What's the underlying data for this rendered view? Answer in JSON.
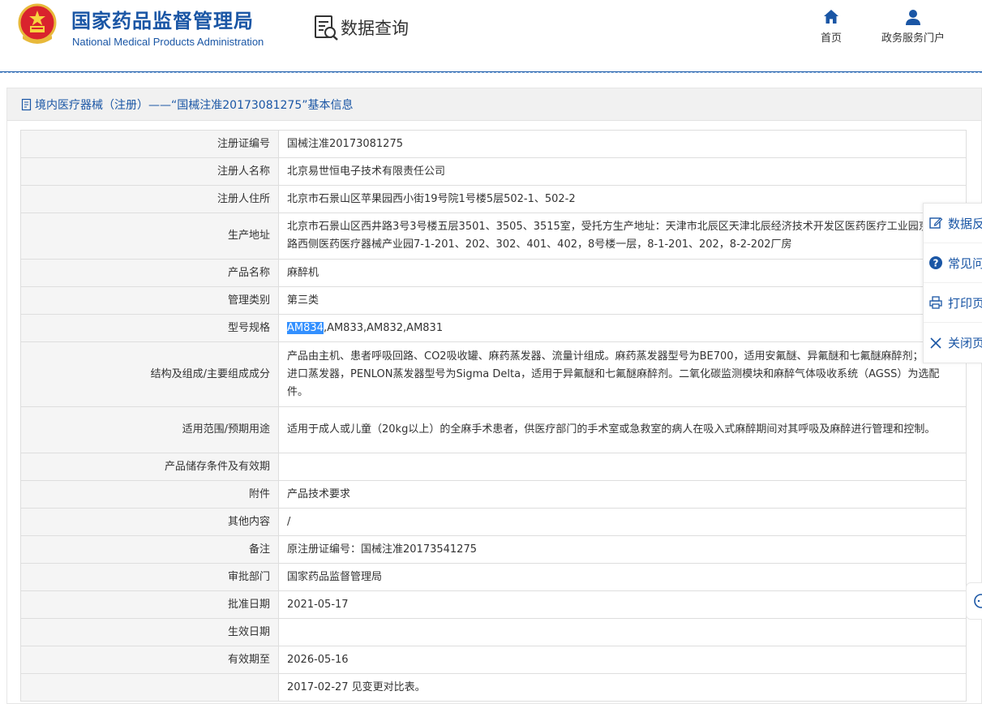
{
  "header": {
    "org_cn": "国家药品监督管理局",
    "org_en": "National Medical Products Administration",
    "query_title": "数据查询",
    "nav": {
      "home": "首页",
      "portal": "政务服务门户"
    }
  },
  "panel": {
    "title": "境内医疗器械（注册）——“国械注准20173081275”基本信息"
  },
  "rows": [
    {
      "label": "注册证编号",
      "value": "国械注准20173081275"
    },
    {
      "label": "注册人名称",
      "value": "北京易世恒电子技术有限责任公司"
    },
    {
      "label": "注册人住所",
      "value": "北京市石景山区苹果园西小街19号院1号楼5层502-1、502-2"
    },
    {
      "label": "生产地址",
      "value": "北京市石景山区西井路3号3号楼五层3501、3505、3515室，受托方生产地址：天津市北辰区天津北辰经济技术开发区医药医疗工业园京福公路西侧医药医疗器械产业园7-1-201、202、302、401、402，8号楼一层，8-1-201、202，8-2-202厂房"
    },
    {
      "label": "产品名称",
      "value": "麻醉机"
    },
    {
      "label": "管理类别",
      "value": "第三类"
    },
    {
      "label": "型号规格",
      "value_selected": "AM834",
      "value_rest": ",AM833,AM832,AM831"
    },
    {
      "label": "结构及组成/主要组成成分",
      "value": "产品由主机、患者呼吸回路、CO2吸收罐、麻药蒸发器、流量计组成。麻药蒸发器型号为BE700，适用安氟醚、异氟醚和七氟醚麻醉剂；可选配进口蒸发器，PENLON蒸发器型号为Sigma Delta，适用于异氟醚和七氟醚麻醉剂。二氧化碳监测模块和麻醉气体吸收系统（AGSS）为选配件。"
    },
    {
      "label": "适用范围/预期用途",
      "value": "适用于成人或儿童（20kg以上）的全麻手术患者，供医疗部门的手术室或急救室的病人在吸入式麻醉期间对其呼吸及麻醉进行管理和控制。"
    },
    {
      "label": "产品储存条件及有效期",
      "value": ""
    },
    {
      "label": "附件",
      "value": "产品技术要求"
    },
    {
      "label": "其他内容",
      "value": "/"
    },
    {
      "label": "备注",
      "value": "原注册证编号：国械注准20173541275"
    },
    {
      "label": "审批部门",
      "value": "国家药品监督管理局"
    },
    {
      "label": "批准日期",
      "value": "2021-05-17"
    },
    {
      "label": "生效日期",
      "value": ""
    },
    {
      "label": "有效期至",
      "value": "2026-05-16"
    },
    {
      "label": "",
      "value": "2017-02-27 见变更对比表。"
    }
  ],
  "tools": {
    "feedback": "数据反",
    "faq": "常见问",
    "print": "打印页",
    "close": "关闭页"
  },
  "colors": {
    "brand": "#1a56a5",
    "selection": "#3390ff",
    "label_bg": "#f5f5f5"
  }
}
